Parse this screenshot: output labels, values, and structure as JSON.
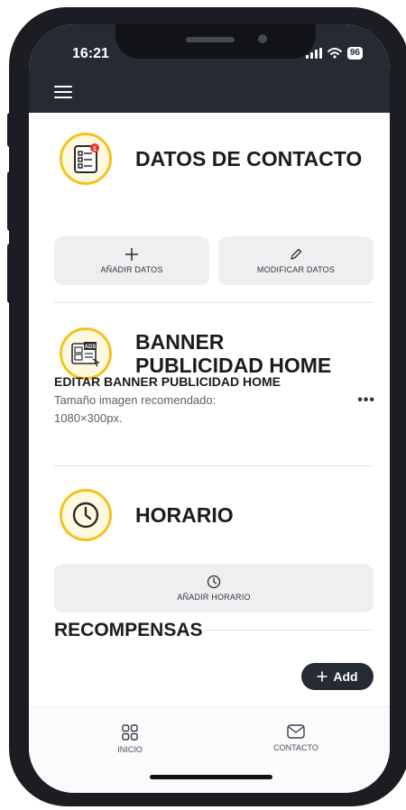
{
  "status_bar": {
    "time": "16:21",
    "battery": "96"
  },
  "sections": {
    "contact": {
      "title": "DATOS DE CONTACTO",
      "add_label": "AÑADIR DATOS",
      "edit_label": "MODIFICAR DATOS"
    },
    "banner": {
      "title": "BANNER PUBLICIDAD HOME",
      "item_title": "EDITAR BANNER PUBLICIDAD HOME",
      "item_subtitle": "Tamaño imagen recomendado: 1080×300px.",
      "ads_badge": "ADS"
    },
    "schedule": {
      "title": "HORARIO",
      "add_label": "AÑADIR HORARIO"
    },
    "rewards": {
      "title": "RECOMPENSAS",
      "add_button": "Add"
    }
  },
  "tabbar": {
    "items": [
      {
        "label": "INICIO",
        "icon": "grid-icon"
      },
      {
        "label": "CONTACTO",
        "icon": "mail-icon"
      }
    ]
  },
  "colors": {
    "accent": "#f5c21b",
    "header": "#262a33",
    "badge": "#e53935"
  }
}
